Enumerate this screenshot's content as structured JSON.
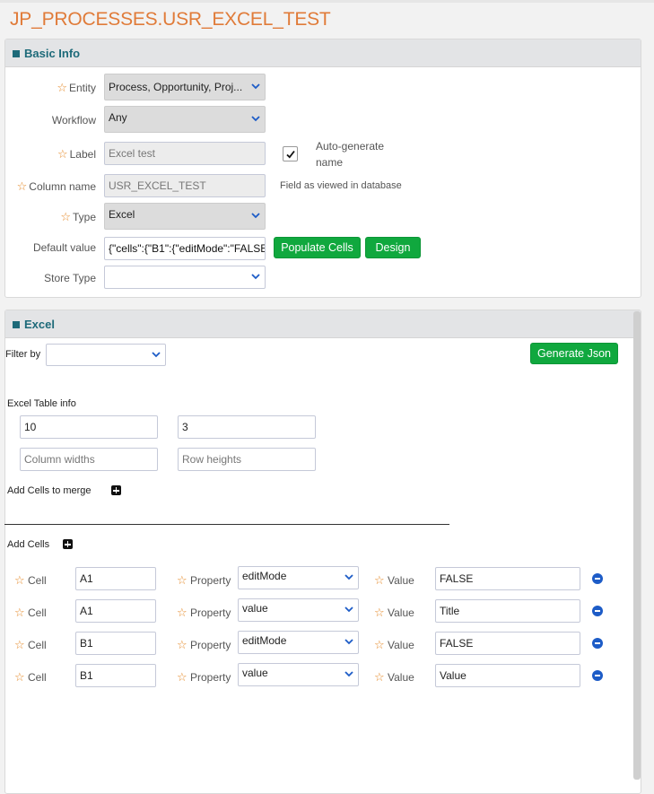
{
  "page": {
    "title": "JP_PROCESSES.USR_EXCEL_TEST"
  },
  "basic_info": {
    "title": "Basic Info",
    "entity": {
      "label": "Entity",
      "value": "Process, Opportunity, Proj..."
    },
    "workflow": {
      "label": "Workflow",
      "value": "Any"
    },
    "label_field": {
      "label": "Label",
      "value": "Excel test"
    },
    "autogen": {
      "line1": "Auto-generate",
      "line2": "name",
      "checked": true
    },
    "column_name": {
      "label": "Column name",
      "value": "USR_EXCEL_TEST",
      "note": "Field as viewed in database"
    },
    "type": {
      "label": "Type",
      "value": "Excel"
    },
    "default_value": {
      "label": "Default value",
      "value": "{\"cells\":{\"B1\":{\"editMode\":\"FALSE"
    },
    "populate_button": "Populate Cells",
    "design_button": "Design",
    "store_type": {
      "label": "Store Type",
      "value": ""
    }
  },
  "excel": {
    "title": "Excel",
    "filter_label": "Filter by",
    "filter_value": "",
    "generate_button": "Generate Json",
    "table_info_label": "Excel Table info",
    "rows_value": "10",
    "cols_value": "3",
    "column_widths_placeholder": "Column widths",
    "row_heights_placeholder": "Row heights",
    "merge_label": "Add Cells to merge",
    "add_cells_label": "Add Cells",
    "cell_label": "Cell",
    "property_label": "Property",
    "value_label": "Value",
    "cells": [
      {
        "cell": "A1",
        "property": "editMode",
        "value": "FALSE"
      },
      {
        "cell": "A1",
        "property": "value",
        "value": "Title"
      },
      {
        "cell": "B1",
        "property": "editMode",
        "value": "FALSE"
      },
      {
        "cell": "B1",
        "property": "value",
        "value": "Value"
      }
    ]
  },
  "colors": {
    "title": "#e07b39",
    "accent": "#1d6a79",
    "button": "#10a83e",
    "star": "#e58a2a",
    "remove": "#1d5cc7"
  }
}
